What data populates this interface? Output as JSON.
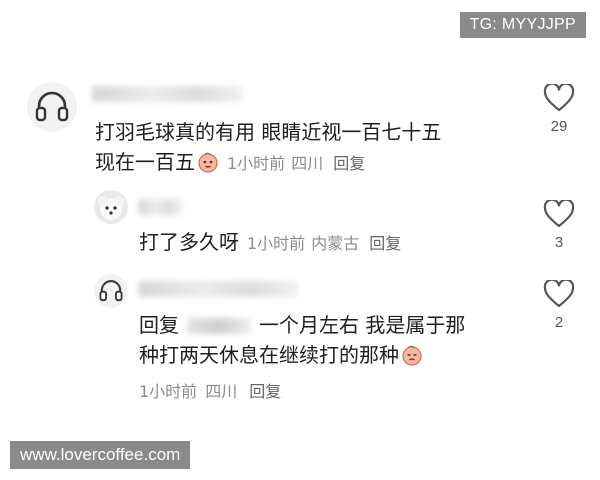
{
  "watermarks": {
    "top": "TG: MYYJJPP",
    "bottom": "www.lovercoffee.com"
  },
  "comments": [
    {
      "text_line1": "打羽毛球真的有用 眼睛近视一百七十五",
      "text_line2": "现在一百五",
      "time": "1小时前",
      "location": "四川",
      "reply_label": "回复",
      "likes": "29",
      "emoji": "peach-face-emoji"
    },
    {
      "text_line1": "打了多久呀",
      "time": "1小时前",
      "location": "内蒙古",
      "reply_label": "回复",
      "likes": "3"
    },
    {
      "reply_prefix": "回复",
      "text_line1": "一个月左右 我是属于那",
      "text_line2": "种打两天休息在继续打的那种",
      "time": "1小时前",
      "location": "四川",
      "reply_label": "回复",
      "likes": "2",
      "emoji": "peach-face-emoji"
    }
  ],
  "colors": {
    "watermark_bg": "#8a8a8a",
    "meta_text": "#8c8c8c",
    "heart_stroke": "#555555"
  }
}
